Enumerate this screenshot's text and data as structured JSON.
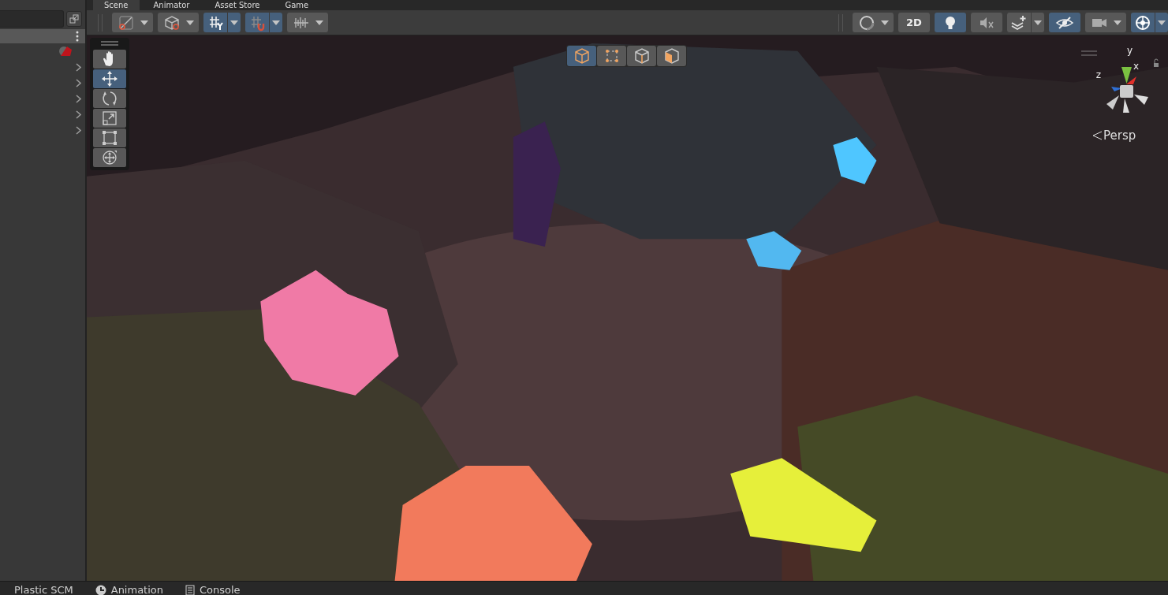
{
  "hierarchy": {
    "header": {
      "selected": true
    },
    "rows": [
      {
        "expanded": false
      },
      {
        "expanded": false
      },
      {
        "expanded": false
      },
      {
        "expanded": false
      },
      {
        "expanded": false
      }
    ]
  },
  "scene_tabs": [
    {
      "label": "Scene",
      "selected": true
    },
    {
      "label": "Animator",
      "selected": false
    },
    {
      "label": "Asset Store",
      "selected": false
    },
    {
      "label": "Game",
      "selected": false
    }
  ],
  "toolbar_left": [
    {
      "kind": "dropdown",
      "on": false
    },
    {
      "kind": "dropdown",
      "on": false
    },
    {
      "kind": "split",
      "on": true
    },
    {
      "kind": "split",
      "on": true
    },
    {
      "kind": "dropdown",
      "on": false
    }
  ],
  "toolbar_right": [
    {
      "kind": "dropdown",
      "on": false
    },
    {
      "kind": "text",
      "label": "2D",
      "on": false
    },
    {
      "kind": "plain",
      "on": true
    },
    {
      "kind": "plain",
      "on": false
    },
    {
      "kind": "split",
      "on": false
    },
    {
      "kind": "plain",
      "on": true
    },
    {
      "kind": "dropdown",
      "on": false
    },
    {
      "kind": "split",
      "on": true
    }
  ],
  "tools": [
    {
      "selected": false
    },
    {
      "selected": true
    },
    {
      "selected": false
    },
    {
      "selected": false
    },
    {
      "selected": false
    },
    {
      "selected": false
    }
  ],
  "orientation_tools": [
    {
      "selected": true
    },
    {
      "selected": false
    },
    {
      "selected": false
    },
    {
      "selected": false
    }
  ],
  "gizmo": {
    "x_label": "x",
    "y_label": "y",
    "z_label": "z",
    "projection": "Persp"
  },
  "bottom_tabs": [
    {
      "label": "Plastic SCM",
      "kind": "plain"
    },
    {
      "label": "Animation",
      "kind": "clock"
    },
    {
      "label": "Console",
      "kind": "console"
    }
  ]
}
